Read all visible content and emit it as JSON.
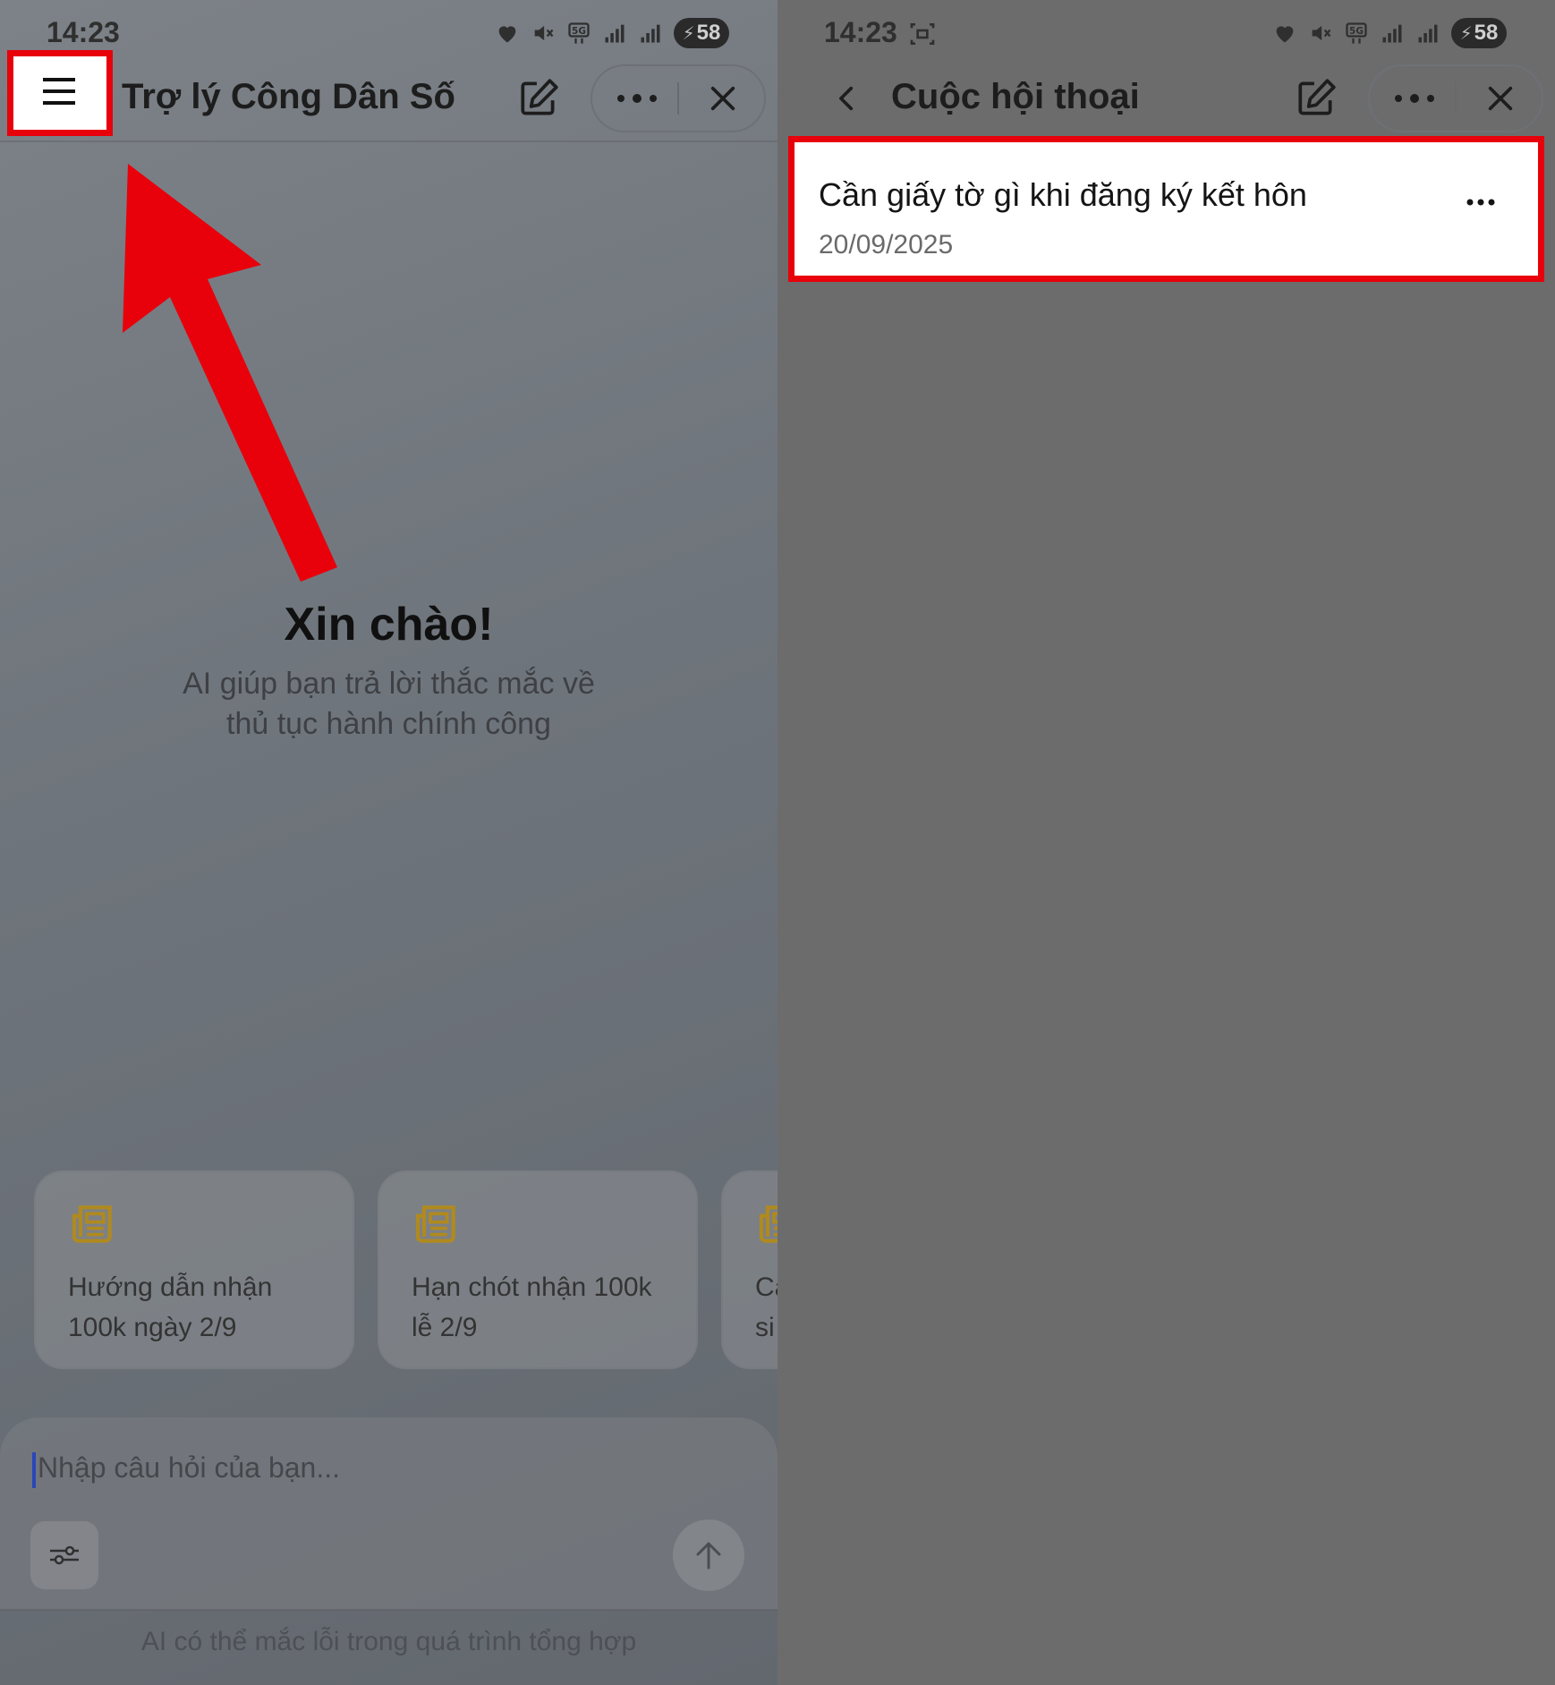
{
  "left_panel": {
    "status_bar": {
      "time": "14:23",
      "battery": "58"
    },
    "app_bar": {
      "title": "Trợ lý Công Dân Số"
    },
    "greeting": {
      "title": "Xin chào!",
      "subtitle_line1": "AI giúp bạn trả lời thắc mắc về",
      "subtitle_line2": "thủ tục hành chính công"
    },
    "suggestions": [
      {
        "line1": "Hướng dẫn nhận",
        "line2": "100k ngày 2/9",
        "icon": "newspaper-icon"
      },
      {
        "line1": "Hạn chót nhận 100k",
        "line2": "lễ 2/9",
        "icon": "newspaper-icon"
      },
      {
        "line1": "Cá",
        "line2": "si",
        "icon": "newspaper-icon"
      }
    ],
    "composer": {
      "placeholder": "Nhập câu hỏi của bạn..."
    },
    "footer_note": "AI có thể mắc lỗi trong quá trình tổng hợp"
  },
  "right_panel": {
    "status_bar": {
      "time": "14:23",
      "battery": "58"
    },
    "app_bar": {
      "title": "Cuộc hội thoại"
    },
    "conversations": [
      {
        "title": "Cần giấy tờ gì khi đăng ký kết hôn",
        "date": "20/09/2025"
      }
    ]
  },
  "colors": {
    "highlight_red": "#e8000b",
    "accent_yellow": "#b08a1e",
    "caret_blue": "#2a46b8"
  }
}
